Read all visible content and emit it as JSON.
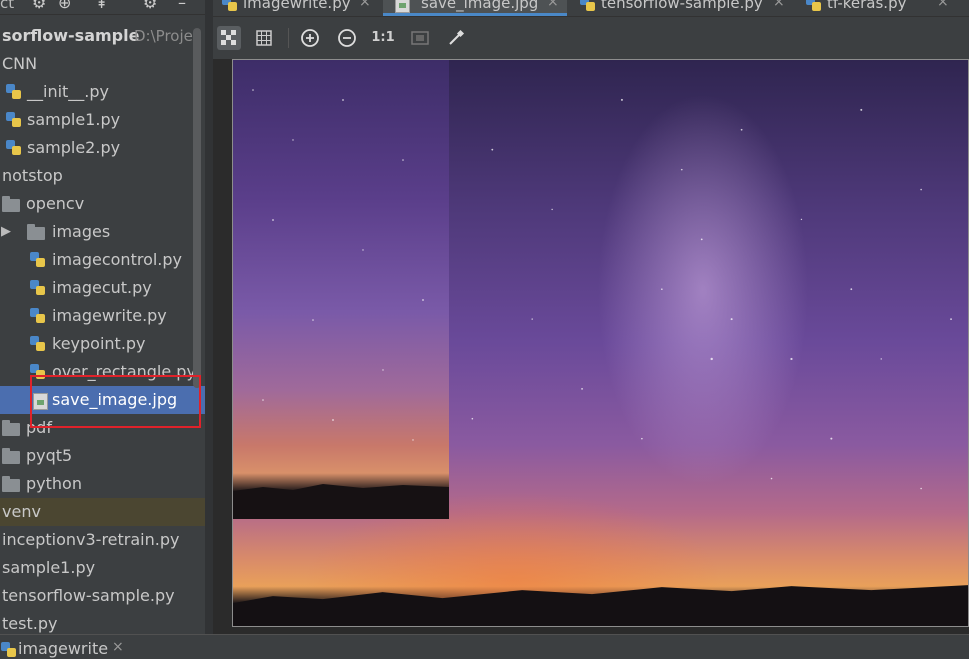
{
  "panel_toolbar": {
    "text": "ct"
  },
  "tabs": [
    {
      "label": "imagewrite.py",
      "icon": "python-file-icon",
      "active": false
    },
    {
      "label": "save_image.jpg",
      "icon": "image-file-icon",
      "active": true
    },
    {
      "label": "tensorflow-sample.py",
      "icon": "python-file-icon",
      "active": false
    },
    {
      "label": "tf-keras.py",
      "icon": "python-file-icon",
      "active": false
    }
  ],
  "tab_close_glyph": "×",
  "tree": {
    "root": {
      "label": "sorflow-sample",
      "path": "D:\\Projec"
    },
    "items": [
      {
        "label": "CNN",
        "type": "folder"
      },
      {
        "label": "__init__.py",
        "type": "python"
      },
      {
        "label": "sample1.py",
        "type": "python"
      },
      {
        "label": "sample2.py",
        "type": "python"
      },
      {
        "label": "notstop",
        "type": "folder"
      },
      {
        "label": "opencv",
        "type": "folder"
      },
      {
        "label": "images",
        "type": "folder",
        "collapsed": true
      },
      {
        "label": "imagecontrol.py",
        "type": "python"
      },
      {
        "label": "imagecut.py",
        "type": "python"
      },
      {
        "label": "imagewrite.py",
        "type": "python"
      },
      {
        "label": "keypoint.py",
        "type": "python"
      },
      {
        "label": "over_rectangle.py",
        "type": "python"
      },
      {
        "label": "save_image.jpg",
        "type": "image",
        "selected": true
      },
      {
        "label": "pdf",
        "type": "folder"
      },
      {
        "label": "pyqt5",
        "type": "folder"
      },
      {
        "label": "python",
        "type": "folder"
      },
      {
        "label": "venv",
        "type": "folder"
      },
      {
        "label": "inceptionv3-retrain.py",
        "type": "python"
      },
      {
        "label": "sample1.py",
        "type": "python"
      },
      {
        "label": "tensorflow-sample.py",
        "type": "python"
      },
      {
        "label": "test.py",
        "type": "python"
      }
    ]
  },
  "image_toolbar": {
    "zoom_reset_label": "1:1",
    "icons": [
      "chessboard-background-icon",
      "grid-icon",
      "zoom-in-icon",
      "zoom-out-icon",
      "actual-size-icon",
      "fit-zoom-icon",
      "color-picker-icon"
    ]
  },
  "colors": {
    "selection": "#4b6eaf",
    "highlight_border": "#e0222a",
    "venv_row": "#4b4631",
    "active_tab_underline": "#4a88c7"
  },
  "bottom_bar": {
    "label": "imagewrite",
    "close": "×"
  }
}
